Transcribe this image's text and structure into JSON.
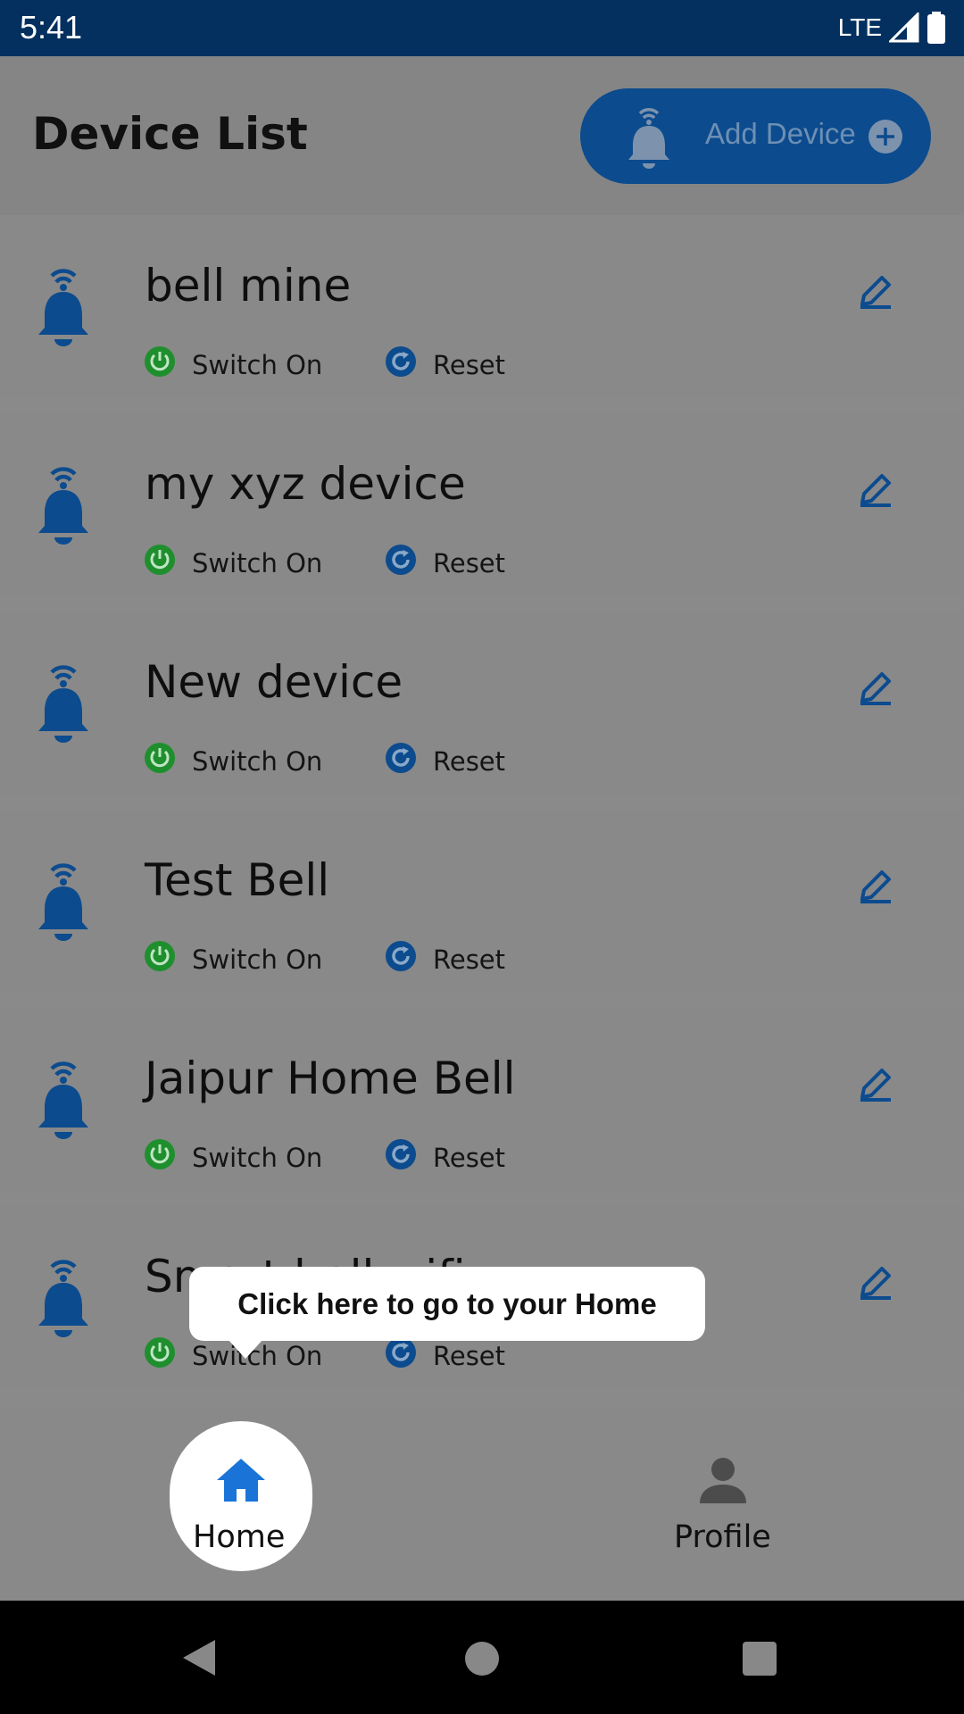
{
  "status_bar": {
    "time": "5:41",
    "network": "LTE"
  },
  "header": {
    "title": "Device List",
    "add_device_label": "Add Device"
  },
  "devices": [
    {
      "name": "bell mine",
      "switch_label": "Switch On",
      "reset_label": "Reset"
    },
    {
      "name": "my xyz device",
      "switch_label": "Switch On",
      "reset_label": "Reset"
    },
    {
      "name": "New device",
      "switch_label": "Switch On",
      "reset_label": "Reset"
    },
    {
      "name": "Test Bell",
      "switch_label": "Switch On",
      "reset_label": "Reset"
    },
    {
      "name": "Jaipur Home Bell",
      "switch_label": "Switch On",
      "reset_label": "Reset"
    },
    {
      "name": "Smart bell wifi",
      "switch_label": "Switch On",
      "reset_label": "Reset"
    }
  ],
  "tooltip": {
    "text": "Click here to go to your Home"
  },
  "bottom_nav": {
    "home_label": "Home",
    "profile_label": "Profile"
  },
  "colors": {
    "accent": "#0c4b8e",
    "power": "#1f8f2e",
    "status_bar": "#04305f"
  },
  "icons": {
    "device": "wifi-bell-icon",
    "edit": "pencil-icon",
    "switch": "power-icon",
    "reset": "refresh-icon"
  }
}
